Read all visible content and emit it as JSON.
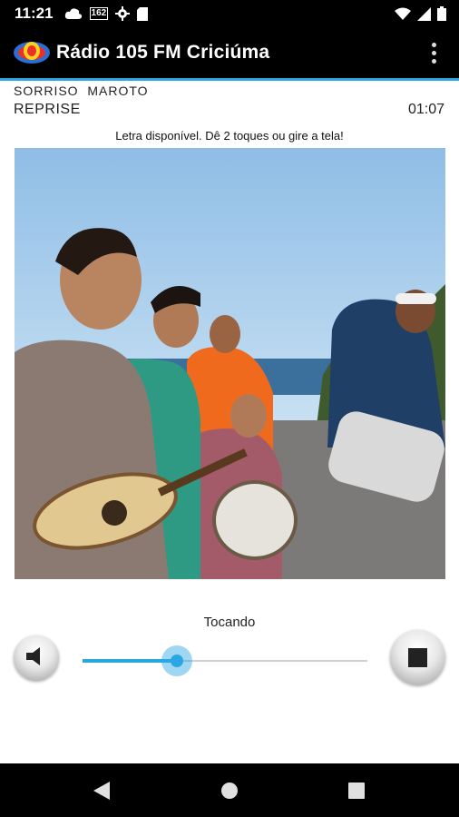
{
  "status_bar": {
    "time": "11:21",
    "icons": [
      "cloud-icon",
      "162-badge-icon",
      "gear-icon",
      "sd-card-icon",
      "wifi-icon",
      "signal-icon",
      "battery-icon"
    ],
    "badge_text": "162"
  },
  "app_bar": {
    "title": "Rádio 105 FM Criciúma",
    "logo": "105fm-logo",
    "menu_icon": "overflow-menu-icon"
  },
  "now_playing": {
    "artist": "SORRISO  MAROTO",
    "song": "REPRISE",
    "duration": "01:07",
    "lyrics_hint": "Letra disponível. Dê 2 toques ou gire a tela!"
  },
  "player": {
    "status": "Tocando",
    "volume_level": 0.33,
    "volume_icon": "speaker-icon",
    "stop_icon": "stop-icon"
  },
  "nav_bar": {
    "icons": [
      "back-icon",
      "home-icon",
      "recents-icon"
    ]
  },
  "colors": {
    "accent": "#2aa6e3",
    "bar_background": "#000000"
  }
}
